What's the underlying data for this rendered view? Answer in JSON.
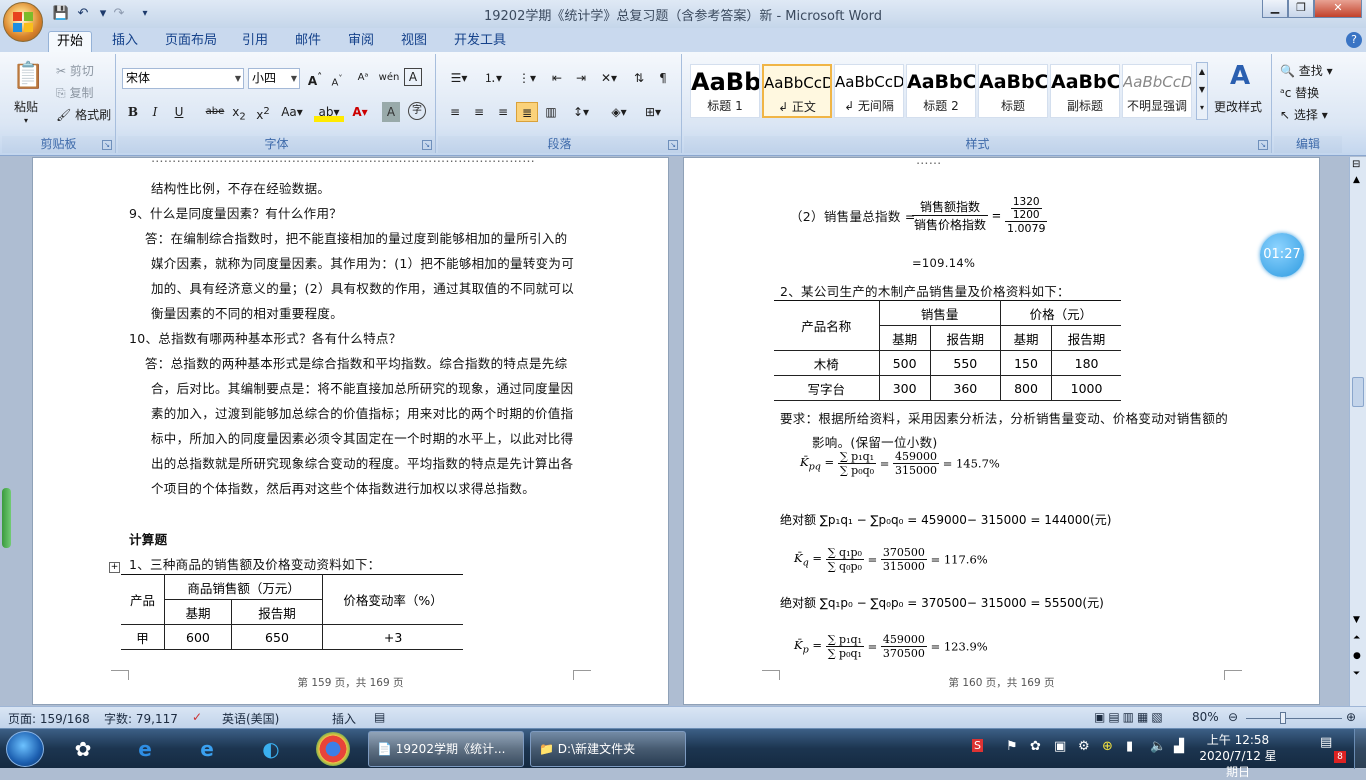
{
  "window": {
    "title": "19202学期《统计学》总复习题（含参考答案）新 - Microsoft Word"
  },
  "tabs": [
    "开始",
    "插入",
    "页面布局",
    "引用",
    "邮件",
    "审阅",
    "视图",
    "开发工具"
  ],
  "clipboard": {
    "paste": "粘贴",
    "cut": "剪切",
    "copy": "复制",
    "format_painter": "格式刷",
    "label": "剪贴板"
  },
  "font": {
    "name": "宋体",
    "size": "小四",
    "label": "字体"
  },
  "paragraph": {
    "label": "段落"
  },
  "styles": {
    "items": [
      {
        "preview": "AaBb",
        "name": "标题 1"
      },
      {
        "preview": "AaBbCcDc",
        "name": "↲ 正文"
      },
      {
        "preview": "AaBbCcDc",
        "name": "↲ 无间隔"
      },
      {
        "preview": "AaBbC",
        "name": "标题 2"
      },
      {
        "preview": "AaBbC",
        "name": "标题"
      },
      {
        "preview": "AaBbC",
        "name": "副标题"
      },
      {
        "preview": "AaBbCcDd",
        "name": "不明显强调"
      }
    ],
    "change": "更改样式",
    "label": "样式"
  },
  "editing": {
    "find": "查找",
    "replace": "替换",
    "select": "选择",
    "label": "编辑"
  },
  "page_left": {
    "lines": [
      "结构性比例，不存在经验数据。",
      "9、什么是同度量因素？有什么作用？",
      "答：在编制综合指数时，把不能直接相加的量过度到能够相加的量所引入的",
      "媒介因素，就称为同度量因素。其作用为：(1）把不能够相加的量转变为可",
      "加的、具有经济意义的量；(2）具有权数的作用，通过其取值的不同就可以",
      "衡量因素的不同的相对重要程度。",
      "10、总指数有哪两种基本形式？各有什么特点？",
      "答：总指数的两种基本形式是综合指数和平均指数。综合指数的特点是先综",
      "合，后对比。其编制要点是：将不能直接加总所研究的现象，通过同度量因",
      "素的加入，过渡到能够加总综合的价值指标；用来对比的两个时期的价值指",
      "标中，所加入的同度量因素必须令其固定在一个时期的水平上，以此对比得",
      "出的总指数就是所研究现象综合变动的程度。平均指数的特点是先计算出各",
      "个项目的个体指数，然后再对这些个体指数进行加权以求得总指数。",
      "计算题",
      "1、三种商品的销售额及价格变动资料如下："
    ],
    "table": {
      "h_product": "产品",
      "h_sales": "商品销售额（万元）",
      "h_base": "基期",
      "h_report": "报告期",
      "h_rate": "价格变动率（%）",
      "row": [
        "甲",
        "600",
        "650",
        "+3"
      ]
    },
    "footer": "第 159 页，共 169 页"
  },
  "page_right": {
    "line_q2": "（2）销售量总指数 =",
    "frac1_num": "销售额指数",
    "frac1_den": "销售价格指数",
    "frac2_num_top": "1320",
    "frac2_num_bot": "1200",
    "frac2_den": "1.0079",
    "result1": "=109.14%",
    "line2": "2、某公司生产的木制产品销售量及价格资料如下：",
    "table": {
      "h_name": "产品名称",
      "h_qty": "销售量",
      "h_price": "价格（元）",
      "h_base": "基期",
      "h_report": "报告期",
      "rows": [
        [
          "木椅",
          "500",
          "550",
          "150",
          "180"
        ],
        [
          "写字台",
          "300",
          "360",
          "800",
          "1000"
        ]
      ]
    },
    "req1": "要求：根据所给资料，采用因素分析法，分析销售量变动、价格变动对销售额的",
    "req2": "影响。(保留一位小数)",
    "f1_num": "459000",
    "f1_den": "315000",
    "f1_res": "= 145.7%",
    "abs1": "绝对额 ∑p₁q₁ − ∑p₀q₀ = 459000− 315000 = 144000(元)",
    "f2_num": "370500",
    "f2_den": "315000",
    "f2_res": "= 117.6%",
    "abs2": "绝对额 ∑q₁p₀ − ∑q₀p₀ = 370500− 315000 = 55500(元)",
    "f3_num": "459000",
    "f3_den": "370500",
    "f3_res": "= 123.9%",
    "footer": "第 160 页，共 169 页"
  },
  "timer": "01:27",
  "status": {
    "page": "页面: 159/168",
    "words": "字数: 79,117",
    "lang": "英语(美国)",
    "mode": "插入",
    "zoom": "80%"
  },
  "taskbar": {
    "word_task": "19202学期《统计...",
    "folder_task": "D:\\新建文件夹",
    "time": "上午 12:58",
    "date": "2020/7/12 星期日",
    "badge": "8"
  }
}
